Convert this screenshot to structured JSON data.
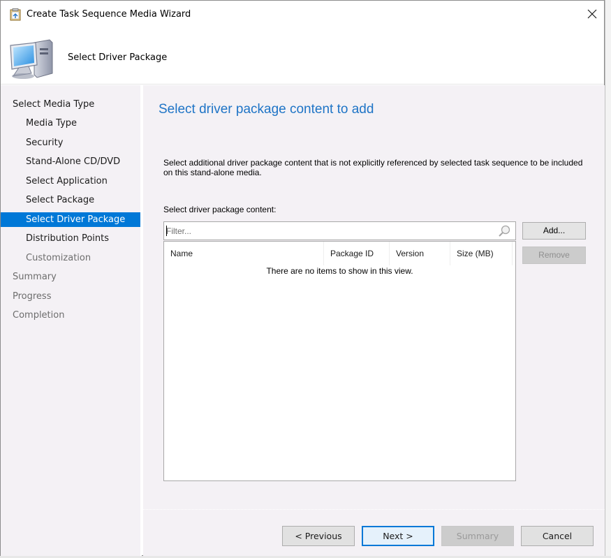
{
  "window": {
    "title": "Create Task Sequence Media Wizard",
    "close_icon": "close-icon"
  },
  "header": {
    "title": "Select Driver Package",
    "icon": "computer-icon"
  },
  "sidebar": {
    "items": [
      {
        "label": "Select Media Type",
        "level": 0,
        "state": "done"
      },
      {
        "label": "Media Type",
        "level": 1,
        "state": "done"
      },
      {
        "label": "Security",
        "level": 1,
        "state": "done"
      },
      {
        "label": "Stand-Alone CD/DVD",
        "level": 1,
        "state": "done"
      },
      {
        "label": "Select Application",
        "level": 1,
        "state": "done"
      },
      {
        "label": "Select Package",
        "level": 1,
        "state": "done"
      },
      {
        "label": "Select Driver Package",
        "level": 1,
        "state": "active"
      },
      {
        "label": "Distribution Points",
        "level": 1,
        "state": "done"
      },
      {
        "label": "Customization",
        "level": 1,
        "state": "pending"
      },
      {
        "label": "Summary",
        "level": 0,
        "state": "pending"
      },
      {
        "label": "Progress",
        "level": 0,
        "state": "pending"
      },
      {
        "label": "Completion",
        "level": 0,
        "state": "pending"
      }
    ]
  },
  "content": {
    "heading": "Select driver package content to add",
    "description": "Select additional driver package content that is not explicitly referenced by selected task sequence to be included on this stand-alone media.",
    "list_label": "Select driver package content:",
    "filter": {
      "value": "",
      "placeholder": "Filter..."
    },
    "columns": [
      "Name",
      "Package ID",
      "Version",
      "Size (MB)"
    ],
    "rows": [],
    "empty_message": "There are no items to show in this view.",
    "add_label": "Add...",
    "remove_label": "Remove"
  },
  "footer": {
    "previous_label": "< Previous",
    "next_label": "Next >",
    "summary_label": "Summary",
    "cancel_label": "Cancel"
  },
  "colors": {
    "accent": "#0078d7",
    "heading": "#1e74c6",
    "panel_bg": "#f4f1f5"
  }
}
